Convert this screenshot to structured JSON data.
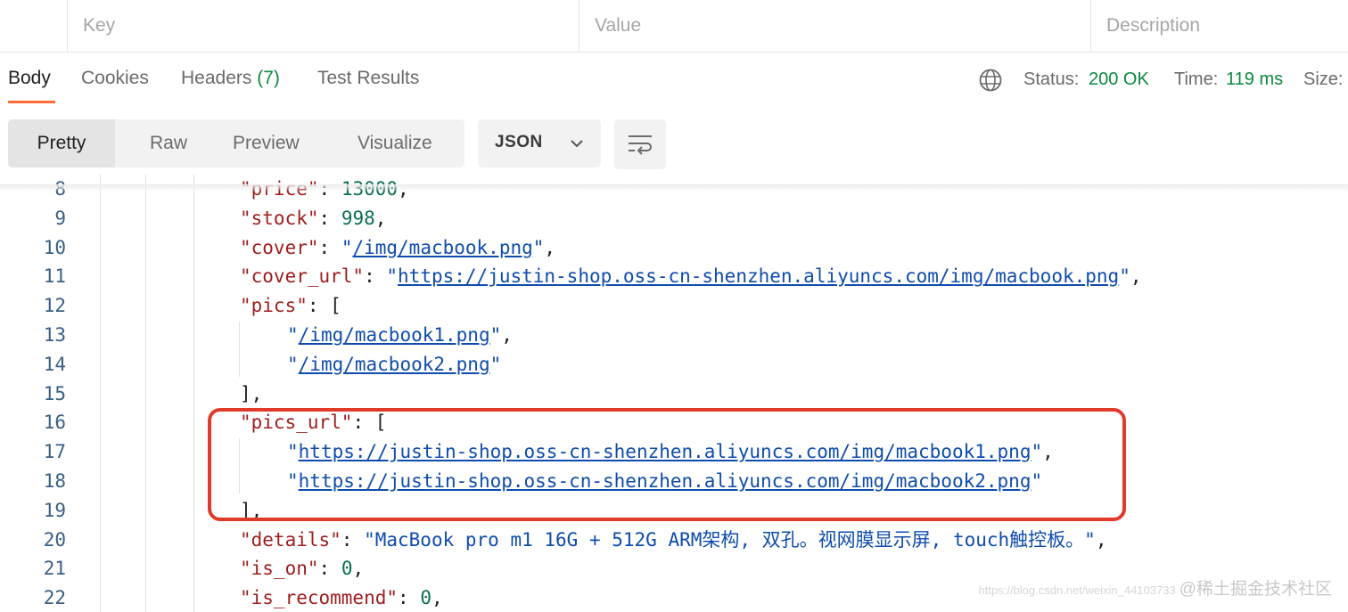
{
  "params_table": {
    "headers": [
      "Key",
      "Value",
      "Description"
    ]
  },
  "response_tabs": {
    "body": "Body",
    "cookies": "Cookies",
    "headers": "Headers",
    "headers_count": "(7)",
    "test_results": "Test Results"
  },
  "status_bar": {
    "status_label": "Status:",
    "status_value": "200 OK",
    "time_label": "Time:",
    "time_value": "119 ms",
    "size_label": "Size:"
  },
  "format_toolbar": {
    "modes": [
      "Pretty",
      "Raw",
      "Preview",
      "Visualize"
    ],
    "active_mode": "Pretty",
    "language": "JSON"
  },
  "code_lines": [
    {
      "n": "8",
      "key": "price",
      "value": "13000",
      "type": "number",
      "suffix": ","
    },
    {
      "n": "9",
      "key": "stock",
      "value": "998",
      "type": "number",
      "suffix": ","
    },
    {
      "n": "10",
      "key": "cover",
      "value": "/img/macbook.png",
      "type": "url",
      "suffix": ","
    },
    {
      "n": "11",
      "key": "cover_url",
      "value": "https://justin-shop.oss-cn-shenzhen.aliyuncs.com/img/macbook.png",
      "type": "url",
      "suffix": ","
    },
    {
      "n": "12",
      "key": "pics",
      "value": "[",
      "type": "open"
    },
    {
      "n": "13",
      "value": "/img/macbook1.png",
      "type": "item-url",
      "suffix": ","
    },
    {
      "n": "14",
      "value": "/img/macbook2.png",
      "type": "item-url",
      "suffix": ""
    },
    {
      "n": "15",
      "value": "],",
      "type": "close"
    },
    {
      "n": "16",
      "key": "pics_url",
      "value": "[",
      "type": "open"
    },
    {
      "n": "17",
      "value": "https://justin-shop.oss-cn-shenzhen.aliyuncs.com/img/macbook1.png",
      "type": "item-url",
      "suffix": ","
    },
    {
      "n": "18",
      "value": "https://justin-shop.oss-cn-shenzhen.aliyuncs.com/img/macbook2.png",
      "type": "item-url",
      "suffix": ""
    },
    {
      "n": "19",
      "value": "],",
      "type": "close"
    },
    {
      "n": "20",
      "key": "details",
      "value": "MacBook pro m1 16G + 512G ARM架构, 双孔。视网膜显示屏, touch触控板。",
      "type": "string",
      "suffix": ","
    },
    {
      "n": "21",
      "key": "is_on",
      "value": "0",
      "type": "number",
      "suffix": ","
    },
    {
      "n": "22",
      "key": "is_recommend",
      "value": "0",
      "type": "number",
      "suffix": ","
    }
  ],
  "watermark": {
    "url_text": "https://blog.csdn.net/weixin_44103733",
    "brand": "@稀土掘金技术社区"
  },
  "colors": {
    "accent_orange": "#ff6c37",
    "status_green": "#0a8a3e",
    "highlight_red": "#e03b2a"
  }
}
